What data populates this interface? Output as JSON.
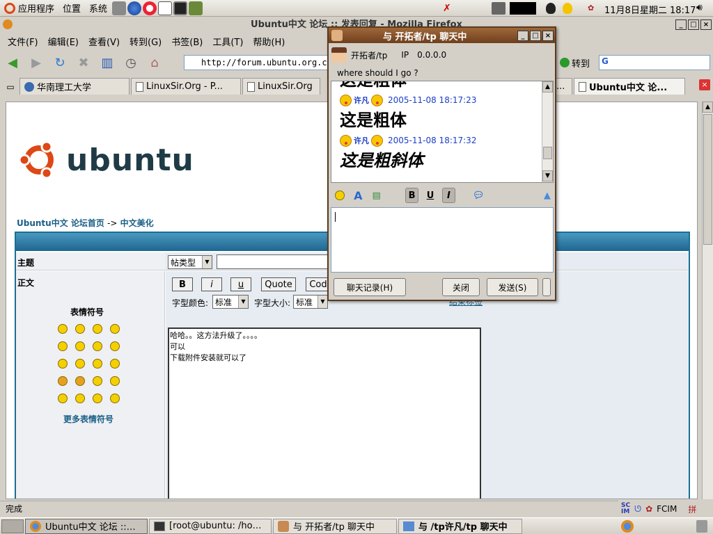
{
  "top_panel": {
    "menus": [
      "应用程序",
      "位置",
      "系统"
    ],
    "clock": "11月8日星期二 18:17"
  },
  "firefox": {
    "title": "Ubuntu中文 论坛 :: 发表回复 - Mozilla Firefox",
    "menu": [
      "文件(F)",
      "编辑(E)",
      "查看(V)",
      "转到(G)",
      "书签(B)",
      "工具(T)",
      "帮助(H)"
    ],
    "url": "http://forum.ubuntu.org.cn",
    "goto_label": "转到",
    "tabs": [
      "华南理工大学",
      "LinuxSir.Org - P...",
      "LinuxSir.Org",
      "...",
      "Ubuntu中文 论..."
    ],
    "status": "完成"
  },
  "page": {
    "logo_text": "ubuntu",
    "breadcrumb_home": "Ubuntu中文 论坛首页",
    "breadcrumb_sep": "->",
    "breadcrumb_section": "中文美化",
    "subject_label": "主题",
    "post_type_value": "帖类型",
    "body_label": "正文",
    "smileys_label": "表情符号",
    "more_smileys": "更多表情符号",
    "btn_bold": "B",
    "btn_italic": "i",
    "btn_underline": "u",
    "btn_quote": "Quote",
    "btn_code": "Cod",
    "font_color_label": "字型颜色:",
    "font_color_value": "标准",
    "font_size_label": "字型大小:",
    "font_size_value": "标准",
    "close_tags": "结束标签",
    "message_lines": [
      "哈哈。。这方法升级了。。。。",
      "可以",
      "下载附件安装就可以了"
    ]
  },
  "chat": {
    "title": "与 开拓者/tp 聊天中",
    "peer": "开拓者/tp",
    "ip_label": "IP",
    "ip": "0.0.0.0",
    "where": "where should I go ?",
    "partial_top": "这是粗体",
    "messages": [
      {
        "name": "许凡",
        "time": "2005-11-08 18:17:23",
        "text": "这是粗体",
        "italic": false
      },
      {
        "name": "许凡",
        "time": "2005-11-08 18:17:32",
        "text": "这是粗斜体",
        "italic": true
      }
    ],
    "btn_history": "聊天记录(H)",
    "btn_close": "关闭",
    "btn_send": "发送(S)"
  },
  "taskbar": {
    "tasks": [
      "Ubuntu中文 论坛 ::…",
      "[root@ubuntu: /ho…",
      "与 开拓者/tp 聊天中",
      "与 /tp许凡/tp 聊天中"
    ],
    "tray_label": "FCIM",
    "tray_ime": "拼"
  },
  "colors": {
    "forum_blue": "#1a6f94",
    "link_blue": "#1a5f86",
    "chat_title": "#6e3f1c",
    "ubuntu_orange": "#dd4814"
  }
}
